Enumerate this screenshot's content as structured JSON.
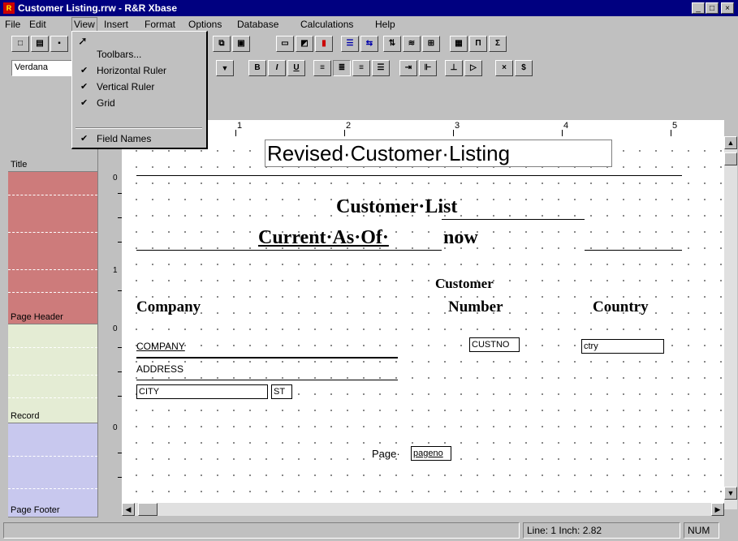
{
  "window": {
    "title": "Customer Listing.rrw - R&R Xbase",
    "app_icon": "rr-app-icon",
    "controls": [
      "_",
      "□",
      "×"
    ]
  },
  "menubar": [
    "File",
    "Edit",
    "View",
    "Insert",
    "Format",
    "Options",
    "Database",
    "Calculations",
    "Help"
  ],
  "active_menu": "View",
  "view_menu": {
    "items": [
      {
        "label": "Toolbars...",
        "checked": false
      },
      {
        "label": "Horizontal Ruler",
        "checked": true
      },
      {
        "label": "Vertical Ruler",
        "checked": true
      },
      {
        "label": "Grid",
        "checked": true
      },
      {
        "label": "Field Names",
        "checked": true
      }
    ]
  },
  "format_toolbar": {
    "font": "Verdana",
    "bold": "B",
    "italic": "I",
    "underline": "U"
  },
  "ruler": {
    "marks": [
      "1",
      "2",
      "3",
      "4",
      "5"
    ]
  },
  "sections": [
    {
      "name": "Title"
    },
    {
      "name": "Page Header"
    },
    {
      "name": "Record"
    },
    {
      "name": "Page Footer"
    }
  ],
  "vertical_ruler": {
    "marks": [
      "0",
      "1",
      "0",
      "0"
    ]
  },
  "report": {
    "report_title": "Revised·Customer·Listing",
    "heading1": "Customer·List",
    "heading2_prefix": "Current·As·Of·",
    "heading2_field": "now",
    "col_company": "Company",
    "col_custnum_1": "Customer",
    "col_custnum_2": "Number",
    "col_country": "Country",
    "field_company": "COMPANY",
    "field_address": "ADDRESS",
    "field_city": "CITY",
    "field_st": "ST",
    "field_custno": "CUSTNO",
    "field_ctry": "ctry",
    "footer_page_label": "Page·",
    "footer_page_field": "pageno"
  },
  "statusbar": {
    "line_info": "Line: 1  Inch: 2.82",
    "num": "NUM"
  }
}
